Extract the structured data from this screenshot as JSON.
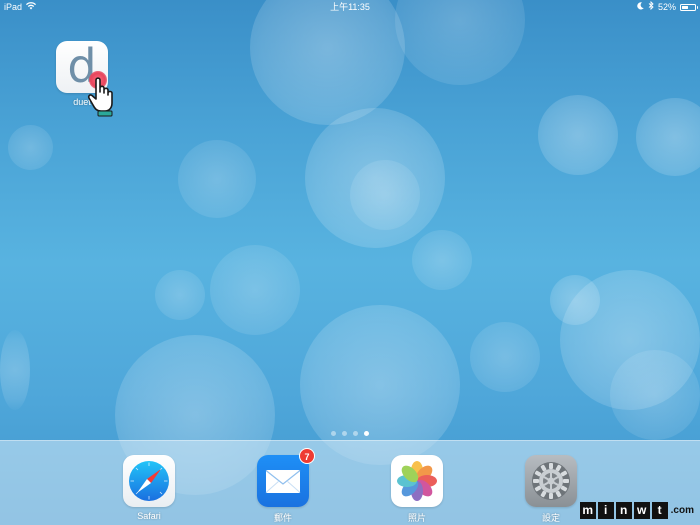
{
  "status_bar": {
    "device": "iPad",
    "time": "上午11:35",
    "battery": "52%",
    "battery_level": 0.52,
    "icons": [
      "wifi-icon",
      "moon-icon",
      "bluetooth-icon"
    ]
  },
  "home_screen": {
    "apps": [
      {
        "id": "duet",
        "label": "duet",
        "glyph": "d",
        "icon": "duet-app-icon"
      }
    ],
    "page_dots": {
      "count": 4,
      "active_index": 3
    }
  },
  "dock": {
    "apps": [
      {
        "id": "safari",
        "label": "Safari",
        "icon": "safari-compass-icon"
      },
      {
        "id": "mail",
        "label": "郵件",
        "icon": "mail-envelope-icon",
        "badge": "7"
      },
      {
        "id": "photos",
        "label": "照片",
        "icon": "photos-flower-icon"
      },
      {
        "id": "settings",
        "label": "設定",
        "icon": "settings-gear-icon"
      }
    ]
  },
  "watermark": {
    "letters": [
      "m",
      "i",
      "n",
      "w",
      "t"
    ],
    "suffix": ".com"
  },
  "colors": {
    "wallpaper_top": "#3a8fc8",
    "wallpaper_mid": "#58b3e0",
    "mail_badge": "#ee3b33",
    "touch_dot": "#e8455c"
  }
}
